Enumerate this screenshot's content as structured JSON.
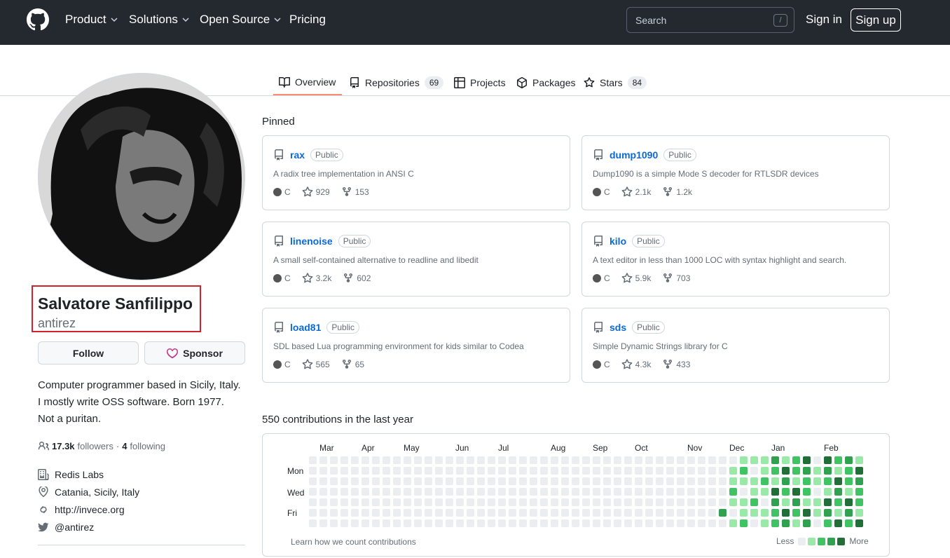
{
  "header": {
    "nav": [
      {
        "label": "Product",
        "dropdown": true
      },
      {
        "label": "Solutions",
        "dropdown": true
      },
      {
        "label": "Open Source",
        "dropdown": true
      },
      {
        "label": "Pricing",
        "dropdown": false
      }
    ],
    "search_placeholder": "Search",
    "search_shortcut": "/",
    "signin": "Sign in",
    "signup": "Sign up"
  },
  "tabs": [
    {
      "label": "Overview",
      "icon": "book-icon",
      "active": true
    },
    {
      "label": "Repositories",
      "icon": "repo-icon",
      "count": "69"
    },
    {
      "label": "Projects",
      "icon": "table-icon"
    },
    {
      "label": "Packages",
      "icon": "package-icon"
    },
    {
      "label": "Stars",
      "icon": "star-icon",
      "count": "84"
    }
  ],
  "profile": {
    "fullname": "Salvatore Sanfilippo",
    "username": "antirez",
    "follow_label": "Follow",
    "sponsor_label": "Sponsor",
    "bio": "Computer programmer based in Sicily, Italy. I mostly write OSS software. Born 1977. Not a puritan.",
    "followers_count": "17.3k",
    "followers_label": "followers",
    "following_count": "4",
    "following_label": "following",
    "company": "Redis Labs",
    "location": "Catania, Sicily, Italy",
    "website": "http://invece.org",
    "twitter": "@antirez"
  },
  "pinned": {
    "title": "Pinned",
    "repos": [
      {
        "name": "rax",
        "visibility": "Public",
        "desc": "A radix tree implementation in ANSI C",
        "lang": "C",
        "stars": "929",
        "forks": "153"
      },
      {
        "name": "dump1090",
        "visibility": "Public",
        "desc": "Dump1090 is a simple Mode S decoder for RTLSDR devices",
        "lang": "C",
        "stars": "2.1k",
        "forks": "1.2k"
      },
      {
        "name": "linenoise",
        "visibility": "Public",
        "desc": "A small self-contained alternative to readline and libedit",
        "lang": "C",
        "stars": "3.2k",
        "forks": "602"
      },
      {
        "name": "kilo",
        "visibility": "Public",
        "desc": "A text editor in less than 1000 LOC with syntax highlight and search.",
        "lang": "C",
        "stars": "5.9k",
        "forks": "703"
      },
      {
        "name": "load81",
        "visibility": "Public",
        "desc": "SDL based Lua programming environment for kids similar to Codea",
        "lang": "C",
        "stars": "565",
        "forks": "65"
      },
      {
        "name": "sds",
        "visibility": "Public",
        "desc": "Simple Dynamic Strings library for C",
        "lang": "C",
        "stars": "4.3k",
        "forks": "433"
      }
    ]
  },
  "contributions": {
    "title": "550 contributions in the last year",
    "months": [
      "Mar",
      "Apr",
      "May",
      "Jun",
      "Jul",
      "Aug",
      "Sep",
      "Oct",
      "Nov",
      "Dec",
      "Jan",
      "Feb"
    ],
    "days": [
      "Mon",
      "Wed",
      "Fri"
    ],
    "learn": "Learn how we count contributions",
    "less": "Less",
    "more": "More",
    "colors": [
      "#ebedf0",
      "#9be9a8",
      "#40c463",
      "#30a14e",
      "#216e39"
    ]
  }
}
